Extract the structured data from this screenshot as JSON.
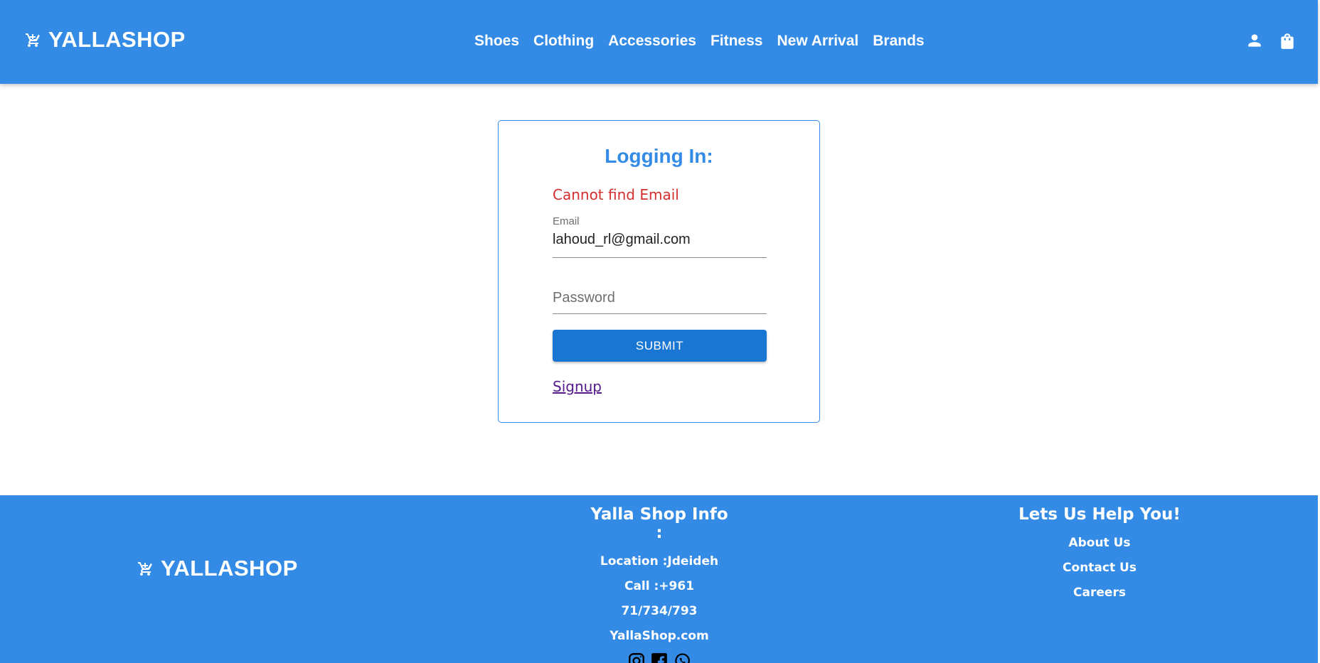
{
  "header": {
    "brand": "YALLASHOP",
    "nav": [
      "Shoes",
      "Clothing",
      "Accessories",
      "Fitness",
      "New Arrival",
      "Brands"
    ],
    "icons": [
      "user-icon",
      "shopping-bag-icon"
    ]
  },
  "login": {
    "title": "Logging In:",
    "error": "Cannot find Email",
    "email_label": "Email",
    "email_value": "lahoud_rl@gmail.com",
    "password_placeholder": "Password",
    "submit_label": "SUBMIT",
    "signup_label": "Signup"
  },
  "footer": {
    "brand": "YALLASHOP",
    "info_title": "Yalla Shop Info :",
    "location": "Location :Jdeideh",
    "call": "Call :+961 71/734/793",
    "website": "YallaShop.com",
    "social_icons": [
      "instagram-icon",
      "facebook-icon",
      "whatsapp-icon"
    ],
    "help_title": "Lets Us Help You!",
    "help_links": [
      "About Us",
      "Contact Us",
      "Careers"
    ]
  },
  "colors": {
    "primary": "#338be6",
    "button": "#1976d2",
    "error": "#d32f2f",
    "link_visited": "#551a8b"
  }
}
